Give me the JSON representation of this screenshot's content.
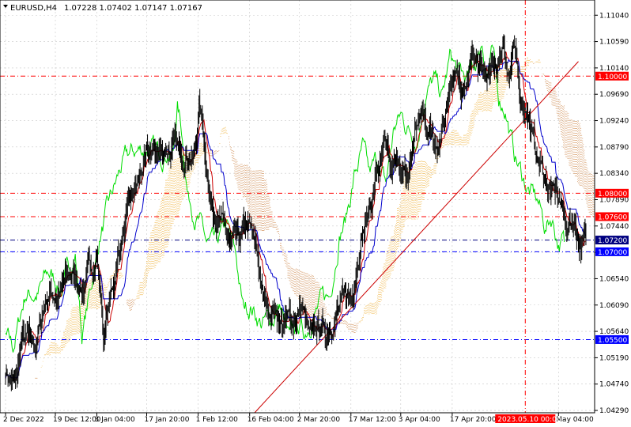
{
  "header": {
    "symbol_label": "EURUSD,H4",
    "ohlc": "1.07228 1.07402 1.07147 1.07167"
  },
  "chart_data": {
    "type": "candlestick",
    "symbol": "EURUSD",
    "timeframe": "H4",
    "ylim": [
      1.0425,
      1.113
    ],
    "grid": true,
    "y_ticks": [
      {
        "label": "1.11040",
        "value": 1.1104
      },
      {
        "label": "1.10590",
        "value": 1.1059
      },
      {
        "label": "1.10140",
        "value": 1.1014
      },
      {
        "label": "1.09690",
        "value": 1.0969
      },
      {
        "label": "1.09240",
        "value": 1.0924
      },
      {
        "label": "1.08790",
        "value": 1.0879
      },
      {
        "label": "1.08340",
        "value": 1.0834
      },
      {
        "label": "1.07890",
        "value": 1.0789
      },
      {
        "label": "1.07440",
        "value": 1.0744
      },
      {
        "label": "1.06990",
        "value": 1.0699
      },
      {
        "label": "1.06540",
        "value": 1.0654
      },
      {
        "label": "1.06090",
        "value": 1.0609
      },
      {
        "label": "1.05640",
        "value": 1.0564
      },
      {
        "label": "1.05190",
        "value": 1.0519
      },
      {
        "label": "1.04740",
        "value": 1.0474
      },
      {
        "label": "1.04290",
        "value": 1.0429
      }
    ],
    "x_ticks": [
      {
        "label": "2 Dec 2022",
        "index": 0
      },
      {
        "label": "19 Dec 12:00",
        "index": 60
      },
      {
        "label": "3 Jan 04:00",
        "index": 110
      },
      {
        "label": "17 Jan 20:00",
        "index": 170
      },
      {
        "label": "1 Feb 12:00",
        "index": 232
      },
      {
        "label": "16 Feb 04:00",
        "index": 294
      },
      {
        "label": "2 Mar 20:00",
        "index": 354
      },
      {
        "label": "17 Mar 12:00",
        "index": 416
      },
      {
        "label": "3 Apr 04:00",
        "index": 476
      },
      {
        "label": "17 Apr 20:00",
        "index": 538
      },
      {
        "label": "May 04:00",
        "index": 666
      }
    ],
    "cursor_time_label": "2023.05.10 00:00",
    "cursor_index": 626,
    "levels": [
      {
        "price": 1.1,
        "label": "1.10000",
        "color": "#ff0000",
        "style": "dashdot"
      },
      {
        "price": 1.08,
        "label": "1.08000",
        "color": "#ff0000",
        "style": "dashdot"
      },
      {
        "price": 1.076,
        "label": "1.07600",
        "color": "#ff0000",
        "style": "dashdot"
      },
      {
        "price": 1.072,
        "label": "1.07200",
        "color": "#000080",
        "style": "dashdot"
      },
      {
        "price": 1.07,
        "label": "1.07000",
        "color": "#0000ff",
        "style": "dashdot"
      },
      {
        "price": 1.055,
        "label": "1.05500",
        "color": "#0000ff",
        "style": "dashdot"
      }
    ],
    "last_price": {
      "price": 1.07167,
      "label": "1.07200"
    },
    "trendline": {
      "start": {
        "index": 300,
        "price": 1.0425
      },
      "end": {
        "index": 690,
        "price": 1.1025
      },
      "color": "#cc0000"
    },
    "colors": {
      "candles": "#000000",
      "chikou_span": "#00dd00",
      "tenkan_sen": "#cc0000",
      "kijun_sen": "#0000cc",
      "kumo_bullish": "#f2c060",
      "kumo_bearish": "#d8a070",
      "grid": "#c8c8c8",
      "cursor_tag": "#ff0000"
    },
    "price_path_anchors": [
      [
        0,
        1.05
      ],
      [
        12,
        1.047
      ],
      [
        20,
        1.055
      ],
      [
        35,
        1.053
      ],
      [
        50,
        1.063
      ],
      [
        65,
        1.063
      ],
      [
        78,
        1.066
      ],
      [
        95,
        1.064
      ],
      [
        110,
        1.07
      ],
      [
        118,
        1.056
      ],
      [
        128,
        1.063
      ],
      [
        140,
        1.073
      ],
      [
        152,
        1.078
      ],
      [
        165,
        1.084
      ],
      [
        175,
        1.086
      ],
      [
        185,
        1.087
      ],
      [
        198,
        1.088
      ],
      [
        210,
        1.086
      ],
      [
        220,
        1.088
      ],
      [
        228,
        1.087
      ],
      [
        233,
        1.095
      ],
      [
        238,
        1.091
      ],
      [
        246,
        1.08
      ],
      [
        258,
        1.076
      ],
      [
        268,
        1.071
      ],
      [
        280,
        1.07
      ],
      [
        292,
        1.074
      ],
      [
        304,
        1.068
      ],
      [
        312,
        1.06
      ],
      [
        322,
        1.061
      ],
      [
        334,
        1.058
      ],
      [
        346,
        1.058
      ],
      [
        356,
        1.061
      ],
      [
        368,
        1.054
      ],
      [
        378,
        1.057
      ],
      [
        386,
        1.056
      ],
      [
        396,
        1.06
      ],
      [
        406,
        1.061
      ],
      [
        416,
        1.062
      ],
      [
        428,
        1.074
      ],
      [
        436,
        1.076
      ],
      [
        446,
        1.083
      ],
      [
        456,
        1.087
      ],
      [
        464,
        1.082
      ],
      [
        474,
        1.085
      ],
      [
        484,
        1.081
      ],
      [
        494,
        1.091
      ],
      [
        502,
        1.093
      ],
      [
        512,
        1.091
      ],
      [
        522,
        1.09
      ],
      [
        532,
        1.098
      ],
      [
        542,
        1.099
      ],
      [
        552,
        1.096
      ],
      [
        562,
        1.103
      ],
      [
        572,
        1.1
      ],
      [
        582,
        1.099
      ],
      [
        592,
        1.102
      ],
      [
        600,
        1.106
      ],
      [
        606,
        1.101
      ],
      [
        612,
        1.104
      ],
      [
        620,
        1.096
      ],
      [
        628,
        1.095
      ],
      [
        638,
        1.087
      ],
      [
        648,
        1.083
      ],
      [
        658,
        1.08
      ],
      [
        668,
        1.078
      ],
      [
        676,
        1.074
      ],
      [
        684,
        1.076
      ],
      [
        692,
        1.072
      ]
    ]
  }
}
